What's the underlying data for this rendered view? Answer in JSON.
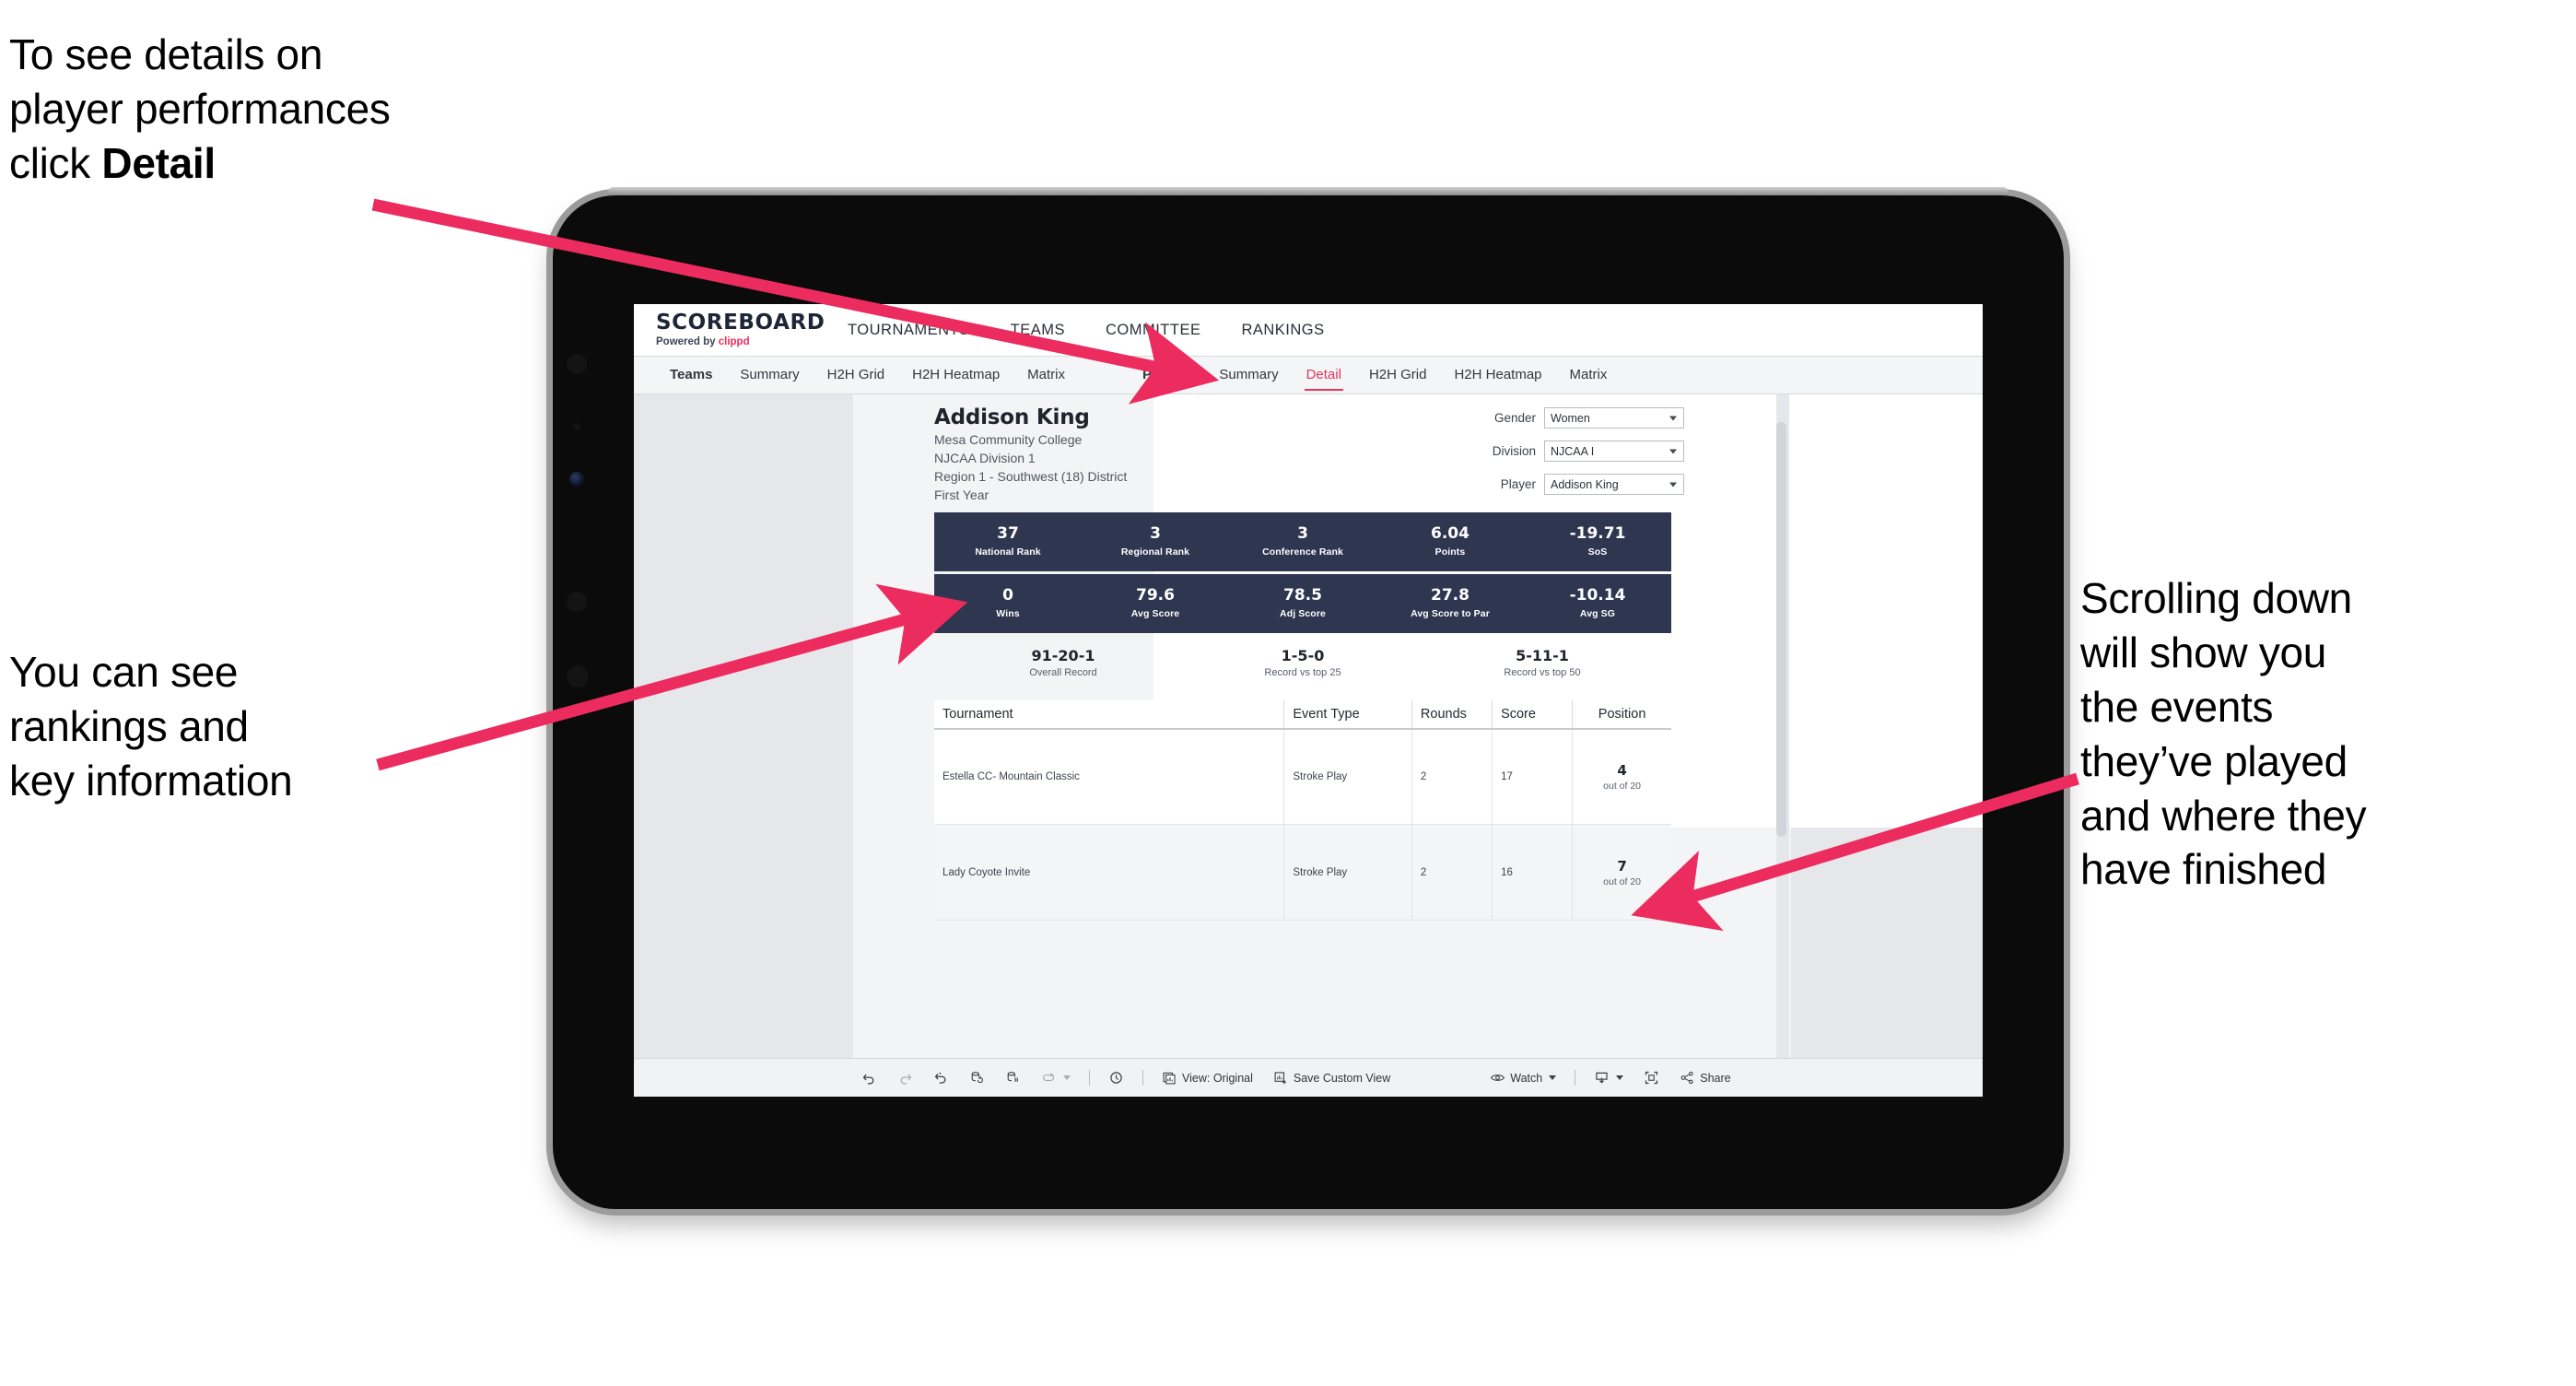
{
  "annotations": {
    "top_left": {
      "line1": "To see details on",
      "line2": "player performances",
      "line3_prefix": "click ",
      "line3_bold": "Detail"
    },
    "mid_left": {
      "line1": "You can see",
      "line2": "rankings and",
      "line3": "key information"
    },
    "right": {
      "line1": "Scrolling down",
      "line2": "will show you",
      "line3": "the events",
      "line4": "they’ve played",
      "line5": "and where they",
      "line6": "have finished"
    },
    "arrow_color": "#ec2b5e"
  },
  "app": {
    "logo": {
      "main": "SCOREBOARD",
      "sub_prefix": "Powered by ",
      "sub_brand": "clippd"
    },
    "top_nav": [
      {
        "label": "TOURNAMENTS"
      },
      {
        "label": "TEAMS"
      },
      {
        "label": "COMMITTEE"
      },
      {
        "label": "RANKINGS"
      }
    ],
    "sub_nav": {
      "teams_group": "Teams",
      "teams_tabs": [
        {
          "label": "Summary",
          "active": false
        },
        {
          "label": "H2H Grid",
          "active": false
        },
        {
          "label": "H2H Heatmap",
          "active": false
        },
        {
          "label": "Matrix",
          "active": false
        }
      ],
      "players_group": "Players",
      "players_tabs": [
        {
          "label": "Summary",
          "active": false
        },
        {
          "label": "Detail",
          "active": true
        },
        {
          "label": "H2H Grid",
          "active": false
        },
        {
          "label": "H2H Heatmap",
          "active": false
        },
        {
          "label": "Matrix",
          "active": false
        }
      ],
      "active_color": "#e8355e"
    }
  },
  "player": {
    "name": "Addison King",
    "college": "Mesa Community College",
    "division": "NJCAA Division 1",
    "region": "Region 1 - Southwest (18) District",
    "year": "First Year"
  },
  "filters": [
    {
      "label": "Gender",
      "value": "Women"
    },
    {
      "label": "Division",
      "value": "NJCAA I"
    },
    {
      "label": "Player",
      "value": "Addison King"
    }
  ],
  "stats_row_1": [
    {
      "value": "37",
      "label": "National Rank"
    },
    {
      "value": "3",
      "label": "Regional Rank"
    },
    {
      "value": "3",
      "label": "Conference Rank"
    },
    {
      "value": "6.04",
      "label": "Points"
    },
    {
      "value": "-19.71",
      "label": "SoS"
    }
  ],
  "stats_row_2": [
    {
      "value": "0",
      "label": "Wins"
    },
    {
      "value": "79.6",
      "label": "Avg Score"
    },
    {
      "value": "78.5",
      "label": "Adj Score"
    },
    {
      "value": "27.8",
      "label": "Avg Score to Par"
    },
    {
      "value": "-10.14",
      "label": "Avg SG"
    }
  ],
  "records": [
    {
      "value": "91-20-1",
      "label": "Overall Record"
    },
    {
      "value": "1-5-0",
      "label": "Record vs top 25"
    },
    {
      "value": "5-11-1",
      "label": "Record vs top 50"
    }
  ],
  "table": {
    "headers": [
      "Tournament",
      "Event Type",
      "Rounds",
      "Score",
      "Position"
    ],
    "rows": [
      {
        "tournament": "Estella CC- Mountain Classic",
        "event_type": "Stroke Play",
        "rounds": "2",
        "score": "17",
        "position_num": "4",
        "position_sub": "out of 20"
      },
      {
        "tournament": "Lady Coyote Invite",
        "event_type": "Stroke Play",
        "rounds": "2",
        "score": "16",
        "position_num": "7",
        "position_sub": "out of 20"
      }
    ]
  },
  "toolbar": {
    "undo": "undo-icon",
    "redo": "redo-icon",
    "revert": "revert-icon",
    "refresh": "refresh-data-icon",
    "pause": "pause-updates-icon",
    "view_original_label": "View: Original",
    "save_custom_view_label": "Save Custom View",
    "watch_label": "Watch",
    "share_label": "Share"
  },
  "theme": {
    "stat_bar_bg": "#2e3650",
    "accent": "#e8355e",
    "screen_bg": "#e6e7ea"
  }
}
